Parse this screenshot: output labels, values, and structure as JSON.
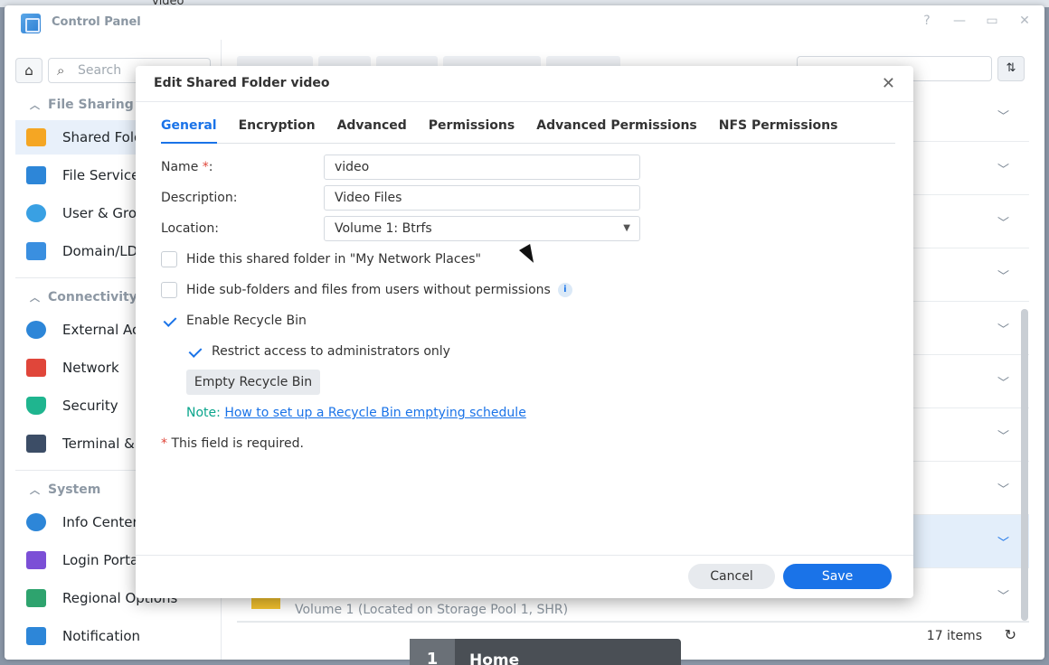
{
  "window": {
    "background_title": "video",
    "title": "Control Panel",
    "controls": [
      "?",
      "—",
      "▭",
      "✕"
    ]
  },
  "sidebar": {
    "search_placeholder": "Search",
    "sections": [
      {
        "label": "File Sharing",
        "items": [
          {
            "label": "Shared Folder",
            "icon": "folder-icon",
            "color": "#f5a623",
            "active": true
          },
          {
            "label": "File Services",
            "icon": "file-services-icon",
            "color": "#2d86d8"
          },
          {
            "label": "User & Group",
            "icon": "user-group-icon",
            "color": "#39a0e3"
          },
          {
            "label": "Domain/LDAP",
            "icon": "domain-icon",
            "color": "#3a8fe0"
          }
        ]
      },
      {
        "label": "Connectivity",
        "items": [
          {
            "label": "External Access",
            "icon": "external-access-icon",
            "color": "#2d86d8"
          },
          {
            "label": "Network",
            "icon": "network-icon",
            "color": "#e0463a"
          },
          {
            "label": "Security",
            "icon": "security-icon",
            "color": "#1fb58f"
          },
          {
            "label": "Terminal & SNMP",
            "icon": "terminal-icon",
            "color": "#3c4d66"
          }
        ]
      },
      {
        "label": "System",
        "items": [
          {
            "label": "Info Center",
            "icon": "info-center-icon",
            "color": "#2d86d8"
          },
          {
            "label": "Login Portal",
            "icon": "login-portal-icon",
            "color": "#7b4fd6"
          },
          {
            "label": "Regional Options",
            "icon": "regional-options-icon",
            "color": "#2ea36e"
          },
          {
            "label": "Notification",
            "icon": "notification-icon",
            "color": "#2d86d8"
          }
        ]
      }
    ]
  },
  "main": {
    "row_text": "Volume 1 (Located on Storage Pool 1, SHR)",
    "items_count": "17 items"
  },
  "taskbar": {
    "number": "1",
    "label": "Home"
  },
  "dialog": {
    "title": "Edit Shared Folder video",
    "tabs": [
      "General",
      "Encryption",
      "Advanced",
      "Permissions",
      "Advanced Permissions",
      "NFS Permissions"
    ],
    "active_tab": "General",
    "fields": {
      "name_label": "Name",
      "name_required_mark": "*",
      "name_colon": ":",
      "name_value": "video",
      "description_label": "Description:",
      "description_value": "Video Files",
      "location_label": "Location:",
      "location_value": "Volume 1:  Btrfs"
    },
    "options": {
      "hide_folder": {
        "label": "Hide this shared folder in \"My Network Places\"",
        "checked": false
      },
      "hide_subfolders": {
        "label": "Hide sub-folders and files from users without permissions",
        "checked": false
      },
      "enable_recycle": {
        "label": "Enable Recycle Bin",
        "checked": true
      },
      "restrict_admin": {
        "label": "Restrict access to administrators only",
        "checked": true
      }
    },
    "empty_recycle_label": "Empty Recycle Bin",
    "note_label": "Note:",
    "note_link": "How to set up a Recycle Bin emptying schedule",
    "required_mark": "*",
    "required_note": "This field is required.",
    "cancel_label": "Cancel",
    "save_label": "Save"
  },
  "colors": {
    "accent": "#1a73e8",
    "required": "#e0463a",
    "note": "#0aa58c"
  }
}
